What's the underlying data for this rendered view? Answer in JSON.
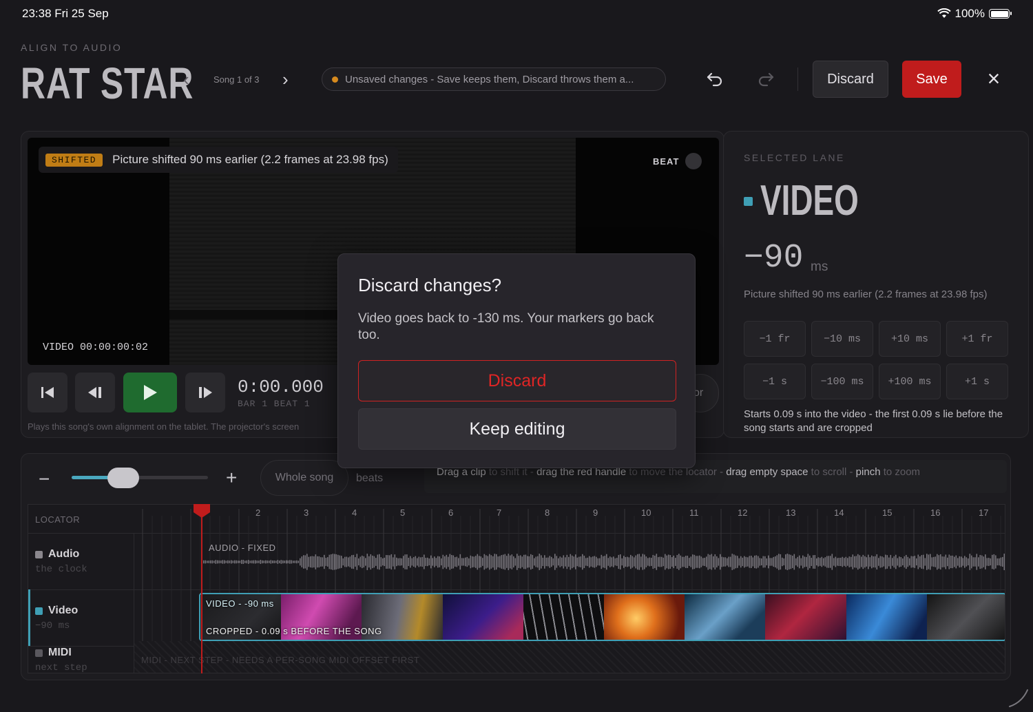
{
  "status_bar": {
    "time_date": "23:38  Fri 25 Sep",
    "battery": "100%"
  },
  "header": {
    "eyebrow": "ALIGN TO AUDIO",
    "title": "RAT STAR",
    "song_label": "Song 1 of 3",
    "unsaved_text": "Unsaved changes - Save keeps them, Discard throws them a...",
    "discard_label": "Discard",
    "save_label": "Save"
  },
  "preview": {
    "shifted_badge": "SHIFTED",
    "shifted_text": "Picture shifted 90 ms earlier (2.2 frames at 23.98 fps)",
    "beat_label": "BEAT",
    "video_timecode": "VIDEO 00:00:00:02",
    "timecode": "0:00.000",
    "bar_beat": "BAR 1  BEAT 1",
    "hint": "Plays this song's own alignment on the tablet. The projector's screen",
    "right_pill": "or"
  },
  "selected_lane": {
    "eyebrow": "SELECTED LANE",
    "name": "VIDEO",
    "offset_value": "−90",
    "offset_unit": "ms",
    "description": "Picture shifted 90 ms earlier (2.2 frames at 23.98 fps)",
    "nudges": [
      "−1 fr",
      "−10 ms",
      "+10 ms",
      "+1 fr",
      "−1 s",
      "−100 ms",
      "+100 ms",
      "+1 s"
    ],
    "note": "Starts 0.09 s into the video - the first 0.09 s lie before the song starts and are cropped",
    "accent": "#3f9fb5"
  },
  "timeline": {
    "whole_song": "Whole song",
    "beats": "beats",
    "hint": [
      {
        "t": "Drag a clip",
        "b": true
      },
      {
        "t": " to shift it  -  ",
        "b": false
      },
      {
        "t": "drag the red handle",
        "b": true
      },
      {
        "t": " to move the locator  -  ",
        "b": false
      },
      {
        "t": "drag empty space",
        "b": true
      },
      {
        "t": " to scroll  -  ",
        "b": false
      },
      {
        "t": "pinch",
        "b": true
      },
      {
        "t": " to zoom",
        "b": false
      }
    ],
    "zoom_level": 0.35,
    "locator_label": "LOCATOR",
    "ruler_ticks": [
      "2",
      "3",
      "4",
      "5",
      "6",
      "7",
      "8",
      "9",
      "10",
      "11",
      "12",
      "13",
      "14",
      "15",
      "16",
      "17"
    ],
    "lanes": {
      "audio": {
        "name": "Audio",
        "sub": "the clock",
        "clip_label": "AUDIO - FIXED",
        "color": "#8a878d"
      },
      "video": {
        "name": "Video",
        "sub": "−90 ms",
        "clip_label": "VIDEO - -90 ms",
        "crop_label": "CROPPED - 0.09 s BEFORE THE SONG",
        "color": "#3f9fb5"
      },
      "midi": {
        "name": "MIDI",
        "sub": "next step",
        "note": "MIDI - NEXT STEP - NEEDS A PER-SONG MIDI OFFSET FIRST",
        "color": "#5a585e"
      }
    }
  },
  "modal": {
    "title": "Discard changes?",
    "body": "Video goes back to -130 ms. Your markers go back too.",
    "discard_label": "Discard",
    "keep_label": "Keep editing"
  }
}
